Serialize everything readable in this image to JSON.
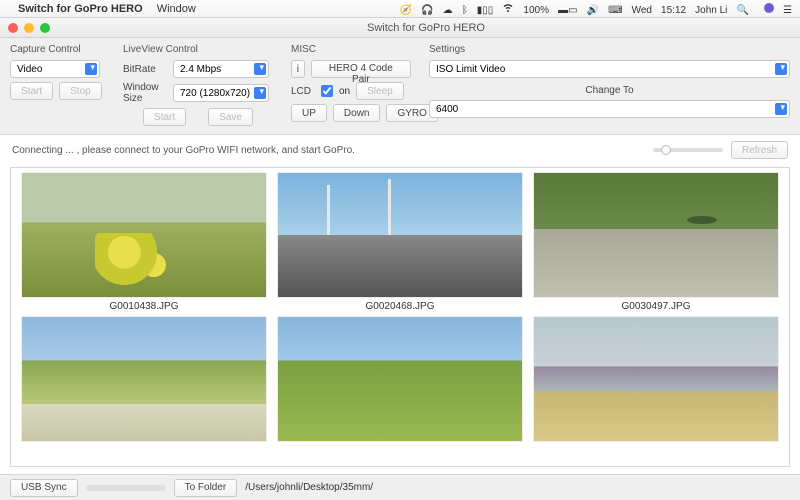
{
  "menubar": {
    "app_name": "Switch for GoPro HERO",
    "menu_window": "Window",
    "battery": "100%",
    "day": "Wed",
    "time": "15:12",
    "user": "John Li"
  },
  "titlebar": {
    "title": "Switch for GoPro HERO"
  },
  "capture": {
    "title": "Capture Control",
    "mode": "Video",
    "start": "Start",
    "stop": "Stop"
  },
  "liveview": {
    "title": "LiveView Control",
    "bitrate_label": "BitRate",
    "bitrate": "2.4 Mbps",
    "winsize_label": "Window Size",
    "winsize": "720 (1280x720)",
    "start": "Start",
    "save": "Save"
  },
  "misc": {
    "title": "MISC",
    "pair_btn": "HERO 4 Code Pair",
    "lcd_label": "LCD",
    "lcd_on": "on",
    "sleep": "Sleep",
    "up": "UP",
    "down": "Down",
    "gyro": "GYRO"
  },
  "settings": {
    "title": "Settings",
    "setting_name": "ISO Limit Video",
    "change_to": "Change To",
    "value": "6400"
  },
  "status_line": "Connecting ... , please connect to your GoPro WIFI network, and start GoPro.",
  "refresh": "Refresh",
  "gallery": {
    "items": [
      {
        "filename": "G0010438.JPG"
      },
      {
        "filename": "G0020468.JPG"
      },
      {
        "filename": "G0030497.JPG"
      },
      {
        "filename": ""
      },
      {
        "filename": ""
      },
      {
        "filename": ""
      }
    ]
  },
  "footer": {
    "usb_sync": "USB Sync",
    "to_folder": "To Folder",
    "path": "/Users/johnli/Desktop/35mm/"
  }
}
